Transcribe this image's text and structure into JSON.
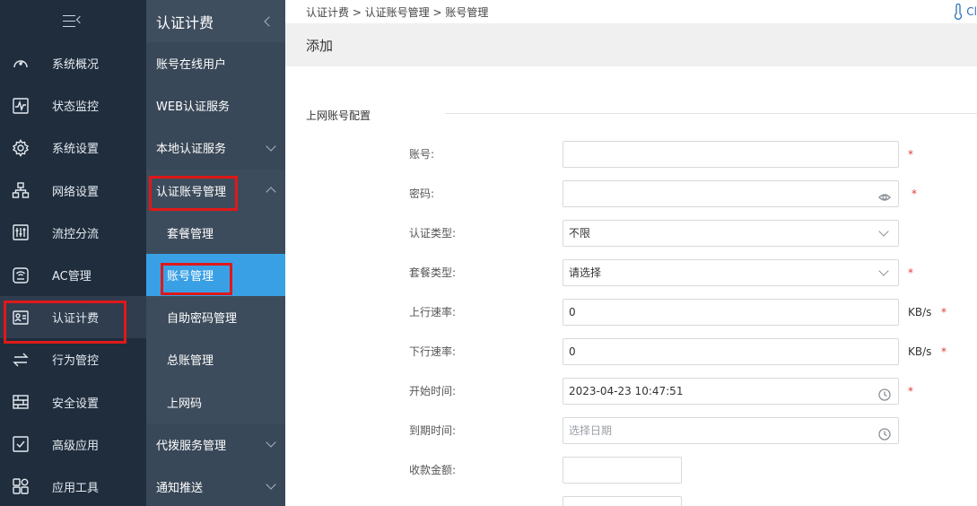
{
  "sidebar": {
    "items": [
      {
        "label": "系统概况",
        "icon": "gauge-icon"
      },
      {
        "label": "状态监控",
        "icon": "monitor-pulse-icon"
      },
      {
        "label": "系统设置",
        "icon": "gear-icon"
      },
      {
        "label": "网络设置",
        "icon": "network-icon"
      },
      {
        "label": "流控分流",
        "icon": "sliders-icon"
      },
      {
        "label": "AC管理",
        "icon": "wifi-router-icon"
      },
      {
        "label": "认证计费",
        "icon": "id-card-icon"
      },
      {
        "label": "行为管控",
        "icon": "swap-arrows-icon"
      },
      {
        "label": "安全设置",
        "icon": "firewall-icon"
      },
      {
        "label": "高级应用",
        "icon": "checkbox-icon"
      },
      {
        "label": "应用工具",
        "icon": "apps-icon"
      }
    ]
  },
  "subnav": {
    "title": "认证计费",
    "items": [
      {
        "label": "账号在线用户"
      },
      {
        "label": "WEB认证服务"
      },
      {
        "label": "本地认证服务"
      },
      {
        "label": "认证账号管理"
      },
      {
        "label": "套餐管理"
      },
      {
        "label": "账号管理"
      },
      {
        "label": "自助密码管理"
      },
      {
        "label": "总账管理"
      },
      {
        "label": "上网码"
      },
      {
        "label": "代拨服务管理"
      },
      {
        "label": "通知推送"
      }
    ]
  },
  "breadcrumb": "认证计费 > 认证账号管理 > 账号管理",
  "breadcrumb_right": "Cl",
  "page_title": "添加",
  "section_title": "上网账号配置",
  "form": {
    "account": {
      "label": "账号:",
      "value": ""
    },
    "password": {
      "label": "密码:",
      "value": ""
    },
    "auth_type": {
      "label": "认证类型:",
      "value": "不限"
    },
    "package_type": {
      "label": "套餐类型:",
      "value": "请选择"
    },
    "up_rate": {
      "label": "上行速率:",
      "value": "0",
      "unit": "KB/s"
    },
    "down_rate": {
      "label": "下行速率:",
      "value": "0",
      "unit": "KB/s"
    },
    "start_time": {
      "label": "开始时间:",
      "value": "2023-04-23 10:47:51"
    },
    "end_time": {
      "label": "到期时间:",
      "placeholder": "选择日期"
    },
    "amount": {
      "label": "收款金额:",
      "value": ""
    }
  },
  "required_mark": "*"
}
